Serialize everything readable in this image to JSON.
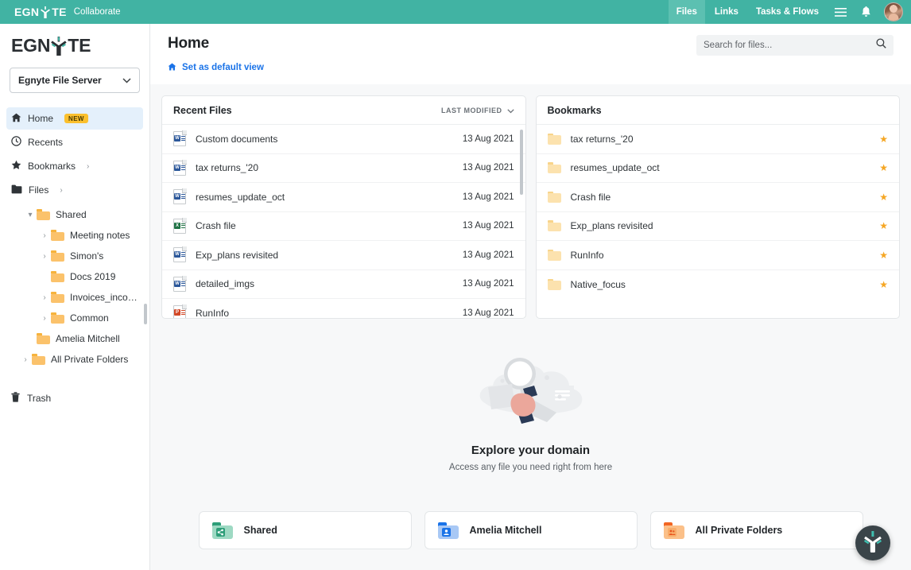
{
  "topbar": {
    "brand_prefix": "EGN",
    "brand_suffix": "TE",
    "product": "Collaborate",
    "nav": [
      {
        "label": "Files",
        "active": true
      },
      {
        "label": "Links",
        "active": false
      },
      {
        "label": "Tasks & Flows",
        "active": false
      }
    ],
    "menu_icon": "hamburger-menu-icon",
    "bell_icon": "notification-bell-icon",
    "avatar": "user-avatar"
  },
  "sidebar": {
    "logo_prefix": "EGN",
    "logo_suffix": "TE",
    "server": {
      "label": "Egnyte File Server",
      "chevron": "chevron-down-icon"
    },
    "nav": [
      {
        "label": "Home",
        "icon": "home-icon",
        "active": true,
        "badge": "NEW"
      },
      {
        "label": "Recents",
        "icon": "clock-icon",
        "active": false
      },
      {
        "label": "Bookmarks",
        "icon": "star-icon",
        "active": false,
        "chevron": "chevron-right-icon"
      },
      {
        "label": "Files",
        "icon": "folder-icon",
        "active": false,
        "chevron": "chevron-right-icon"
      }
    ],
    "tree": [
      {
        "label": "Shared",
        "indent": 1,
        "caret": "expanded"
      },
      {
        "label": "Meeting notes",
        "indent": 2,
        "caret": "collapsed"
      },
      {
        "label": "Simon's",
        "indent": 2,
        "caret": "collapsed"
      },
      {
        "label": "Docs 2019",
        "indent": 2,
        "caret": "none"
      },
      {
        "label": "Invoices_incom...",
        "indent": 2,
        "caret": "collapsed"
      },
      {
        "label": "Common",
        "indent": 2,
        "caret": "collapsed"
      },
      {
        "label": "Amelia Mitchell",
        "indent": 1,
        "caret": "none"
      },
      {
        "label": "All Private Folders",
        "indent": 1,
        "caret": "collapsed"
      }
    ],
    "trash": {
      "label": "Trash",
      "icon": "trash-icon"
    }
  },
  "main": {
    "title": "Home",
    "default_view_link": "Set as default view",
    "default_view_icon": "home-icon",
    "search": {
      "placeholder": "Search for files...",
      "value": "",
      "icon": "search-icon"
    }
  },
  "recent_files": {
    "title": "Recent Files",
    "sort_label": "LAST MODIFIED",
    "sort_icon": "chevron-down-icon",
    "rows": [
      {
        "name": "Custom documents",
        "date": "13 Aug 2021",
        "type": "word"
      },
      {
        "name": "tax returns_'20",
        "date": "13 Aug 2021",
        "type": "word"
      },
      {
        "name": "resumes_update_oct",
        "date": "13 Aug 2021",
        "type": "word"
      },
      {
        "name": "Crash file",
        "date": "13 Aug 2021",
        "type": "excel"
      },
      {
        "name": "Exp_plans revisited",
        "date": "13 Aug 2021",
        "type": "word"
      },
      {
        "name": "detailed_imgs",
        "date": "13 Aug 2021",
        "type": "word"
      },
      {
        "name": "RunInfo",
        "date": "13 Aug 2021",
        "type": "powerpoint"
      }
    ]
  },
  "bookmarks": {
    "title": "Bookmarks",
    "rows": [
      {
        "name": "tax returns_'20",
        "starred": true
      },
      {
        "name": "resumes_update_oct",
        "starred": true
      },
      {
        "name": "Crash file",
        "starred": true
      },
      {
        "name": "Exp_plans revisited",
        "starred": true
      },
      {
        "name": "RunInfo",
        "starred": true
      },
      {
        "name": "Native_focus",
        "starred": true
      }
    ]
  },
  "explore": {
    "title": "Explore your domain",
    "subtitle": "Access any file you need right from here",
    "illustration": "magnifier-hand-documents-illustration",
    "cards": [
      {
        "label": "Shared",
        "icon": "shared-folder-icon",
        "color": "#2e9e79"
      },
      {
        "label": "Amelia Mitchell",
        "icon": "personal-folder-icon",
        "color": "#1a73e8"
      },
      {
        "label": "All Private Folders",
        "icon": "private-folders-icon",
        "color": "#f26522"
      }
    ]
  },
  "help_button": {
    "icon": "egnyte-help-icon"
  },
  "colors": {
    "brand_teal": "#41b3a3",
    "accent_blue": "#1a73e8",
    "star_orange": "#f5a623",
    "badge_yellow": "#fbc02d",
    "word_blue": "#2b579a",
    "excel_green": "#217346",
    "ppt_red": "#d24726",
    "folder_yellow": "#fbd38a"
  }
}
